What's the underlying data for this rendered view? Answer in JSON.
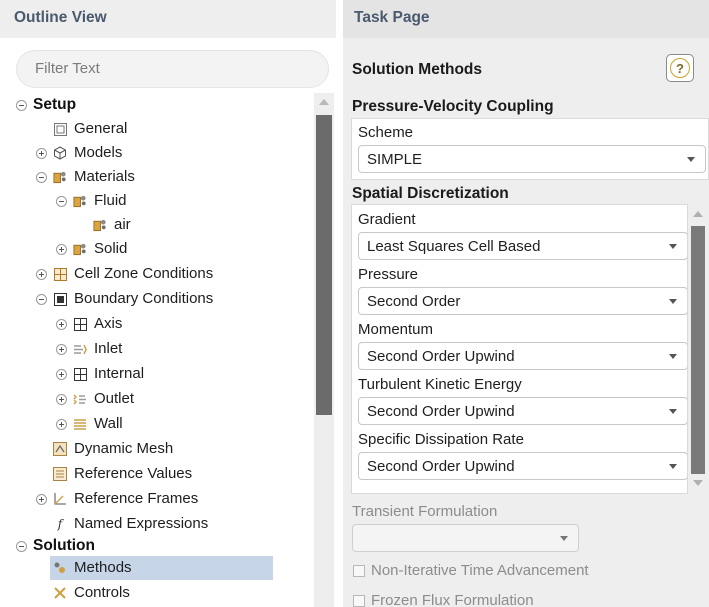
{
  "outline": {
    "title": "Outline View",
    "filter_placeholder": "Filter Text",
    "tree": {
      "setup": "Setup",
      "general": "General",
      "models": "Models",
      "materials": "Materials",
      "fluid": "Fluid",
      "air": "air",
      "solid": "Solid",
      "cell_zone_conditions": "Cell Zone Conditions",
      "boundary_conditions": "Boundary Conditions",
      "axis": "Axis",
      "inlet": "Inlet",
      "internal": "Internal",
      "outlet": "Outlet",
      "wall": "Wall",
      "dynamic_mesh": "Dynamic Mesh",
      "reference_values": "Reference Values",
      "reference_frames": "Reference Frames",
      "named_expressions": "Named Expressions",
      "solution": "Solution",
      "methods": "Methods",
      "controls": "Controls"
    },
    "selected_item": "Methods"
  },
  "task": {
    "title": "Task Page",
    "section_title": "Solution Methods",
    "help_label": "?",
    "pv_coupling": {
      "title": "Pressure-Velocity Coupling",
      "scheme_label": "Scheme",
      "scheme_value": "SIMPLE"
    },
    "spatial": {
      "title": "Spatial Discretization",
      "gradient_label": "Gradient",
      "gradient_value": "Least Squares Cell Based",
      "pressure_label": "Pressure",
      "pressure_value": "Second Order",
      "momentum_label": "Momentum",
      "momentum_value": "Second Order Upwind",
      "tke_label": "Turbulent Kinetic Energy",
      "tke_value": "Second Order Upwind",
      "sdr_label": "Specific Dissipation Rate",
      "sdr_value": "Second Order Upwind"
    },
    "transient": {
      "label": "Transient Formulation",
      "value": "",
      "non_iterative_label": "Non-Iterative Time Advancement",
      "frozen_flux_label": "Frozen Flux Formulation"
    }
  },
  "colors": {
    "selection": "#c6d6e8",
    "header_text": "#4a5a6e",
    "panel_bg": "#eeeeee"
  },
  "icons": [
    "expand-collapse-icon",
    "general-icon",
    "models-icon",
    "materials-icon",
    "zone-icon",
    "inlet-icon",
    "outlet-icon",
    "wall-icon",
    "mesh-icon",
    "reference-values-icon",
    "reference-frames-icon",
    "expression-icon",
    "methods-icon",
    "controls-icon",
    "help-icon"
  ]
}
